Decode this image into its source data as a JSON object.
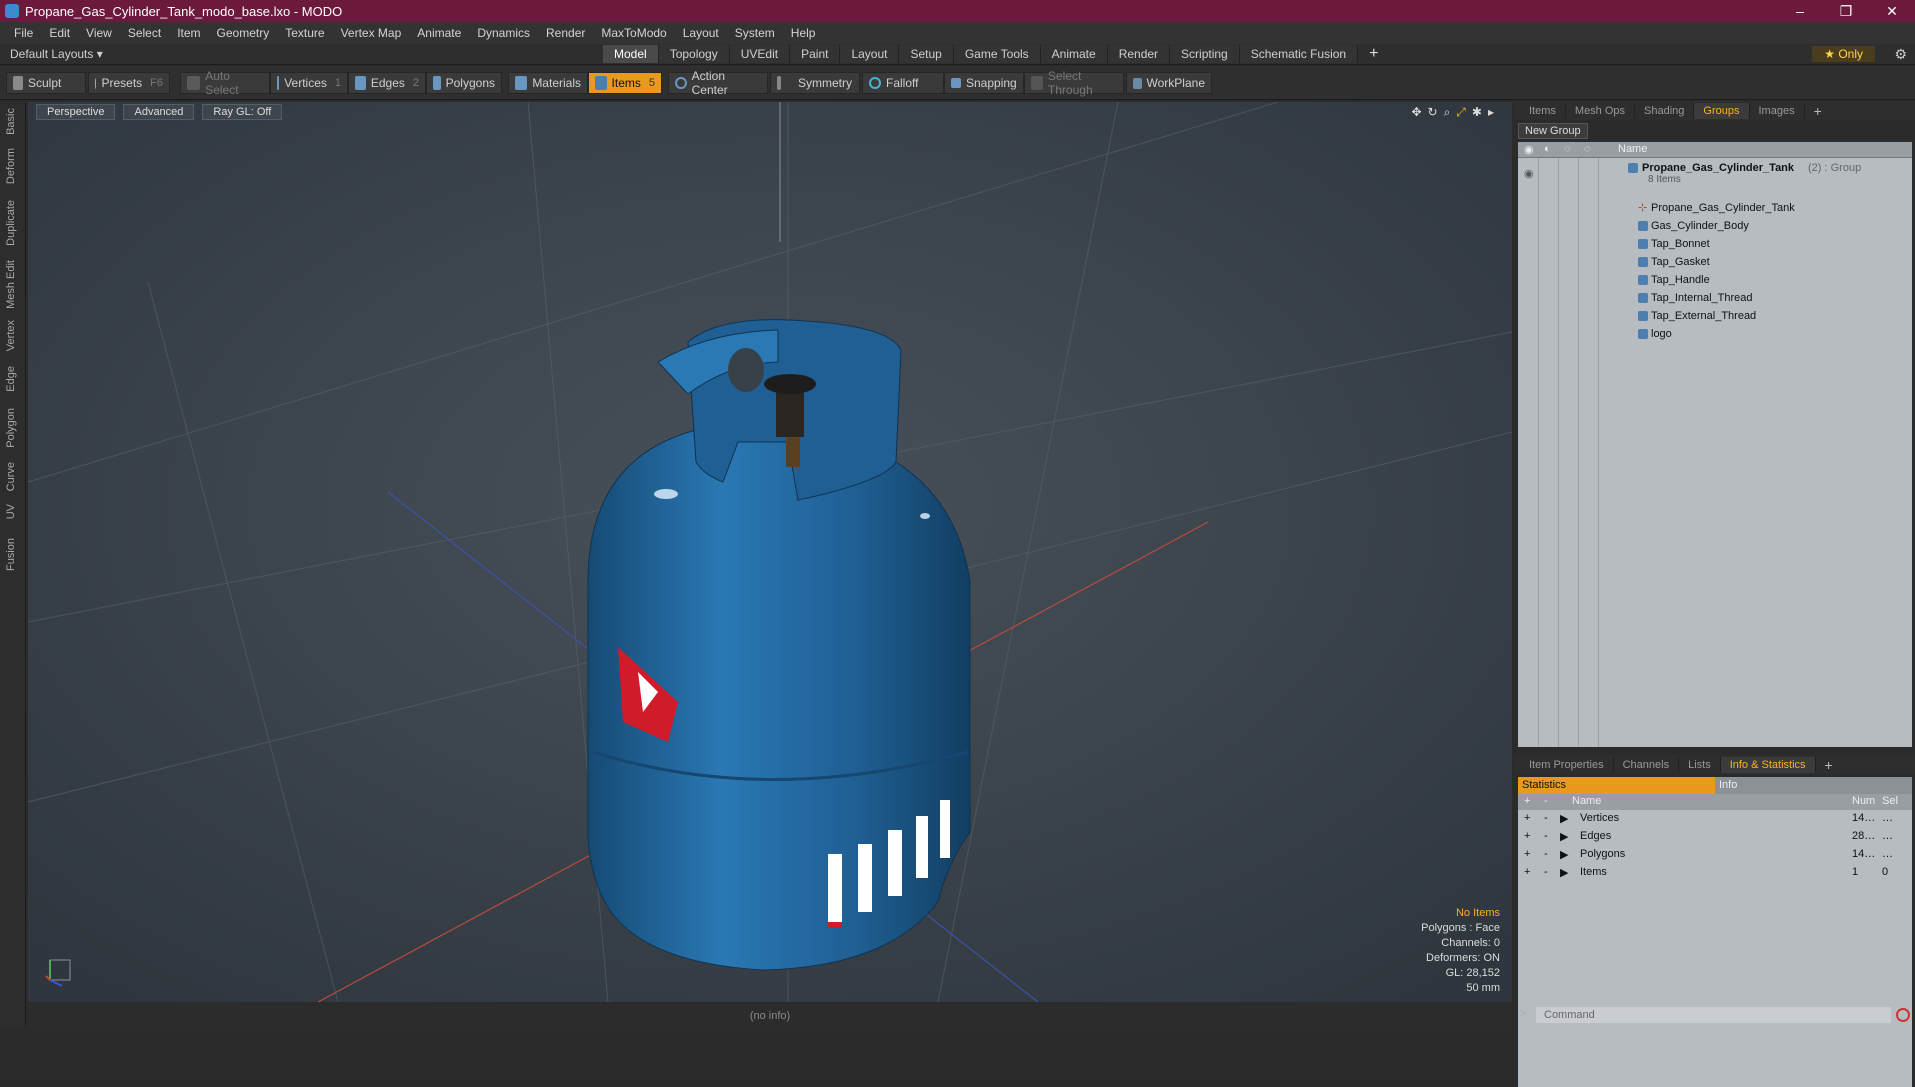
{
  "window": {
    "title": "Propane_Gas_Cylinder_Tank_modo_base.lxo - MODO",
    "controls": [
      "–",
      "❐",
      "✕"
    ]
  },
  "menu": [
    "File",
    "Edit",
    "View",
    "Select",
    "Item",
    "Geometry",
    "Texture",
    "Vertex Map",
    "Animate",
    "Dynamics",
    "Render",
    "MaxToModo",
    "Layout",
    "System",
    "Help"
  ],
  "layoutbar": {
    "layouts_label": "Default Layouts ▾",
    "tabs": [
      "Model",
      "Topology",
      "UVEdit",
      "Paint",
      "Layout",
      "Setup",
      "Game Tools",
      "Animate",
      "Render",
      "Scripting",
      "Schematic Fusion"
    ],
    "active_tab": "Model",
    "only_label": "★  Only"
  },
  "toolbar": {
    "sculpt": "Sculpt",
    "presets": "Presets",
    "presets_key": "F6",
    "auto_select": "Auto Select",
    "vertices": "Vertices",
    "vertices_num": "1",
    "edges": "Edges",
    "edges_num": "2",
    "polygons": "Polygons",
    "materials": "Materials",
    "items": "Items",
    "items_num": "5",
    "action_center": "Action Center",
    "symmetry": "Symmetry",
    "falloff": "Falloff",
    "snapping": "Snapping",
    "select_through": "Select Through",
    "workplane": "WorkPlane"
  },
  "left_tabs": [
    "Basic",
    "Deform",
    "Duplicate",
    "Mesh Edit",
    "Vertex",
    "Edge",
    "Polygon",
    "Curve",
    "UV",
    "Fusion"
  ],
  "viewport": {
    "view_mode": "Perspective",
    "shading": "Advanced",
    "raygl": "Ray GL: Off",
    "info": {
      "items": "No Items",
      "polygons": "Polygons : Face",
      "channels": "Channels: 0",
      "deformers": "Deformers: ON",
      "gl": "GL: 28,152",
      "focal": "50 mm"
    }
  },
  "status": "(no info)",
  "groups_panel": {
    "tabs": [
      "Items",
      "Mesh Ops",
      "Shading",
      "Groups",
      "Images"
    ],
    "active_tab": "Groups",
    "new_group": "New Group",
    "name_header": "Name",
    "group_name": "Propane_Gas_Cylinder_Tank",
    "group_suffix": "(2) : Group",
    "group_count": "8 Items",
    "items": [
      "Propane_Gas_Cylinder_Tank",
      "Gas_Cylinder_Body",
      "Tap_Bonnet",
      "Tap_Gasket",
      "Tap_Handle",
      "Tap_Internal_Thread",
      "Tap_External_Thread",
      "logo"
    ]
  },
  "stats_panel": {
    "tabs": [
      "Item Properties",
      "Channels",
      "Lists",
      "Info & Statistics"
    ],
    "active_tab": "Info & Statistics",
    "subtabs": [
      "Statistics",
      "Info"
    ],
    "headers": {
      "name": "Name",
      "num": "Num",
      "sel": "Sel"
    },
    "rows": [
      {
        "name": "Vertices",
        "num": "14…",
        "sel": "…"
      },
      {
        "name": "Edges",
        "num": "28…",
        "sel": "…"
      },
      {
        "name": "Polygons",
        "num": "14…",
        "sel": "…"
      },
      {
        "name": "Items",
        "num": "1",
        "sel": "0"
      }
    ]
  },
  "command": {
    "placeholder": "Command"
  },
  "colors": {
    "titlebar": "#6b1a3c",
    "accent": "#e89a1e",
    "tank": "#1f5f93"
  }
}
